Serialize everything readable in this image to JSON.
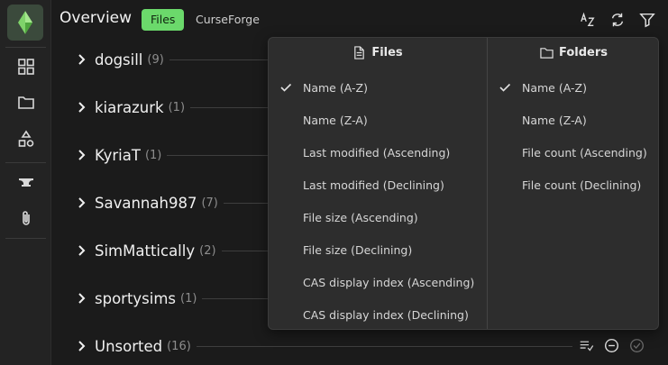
{
  "header": {
    "title": "Overview",
    "tabs": [
      {
        "label": "Files",
        "active": true
      },
      {
        "label": "CurseForge",
        "active": false
      }
    ],
    "icons": [
      "sort-az-icon",
      "refresh-icon",
      "filter-icon"
    ]
  },
  "sidebar": {
    "items": [
      "dashboard-icon",
      "folder-icon",
      "shapes-icon",
      "anvil-icon",
      "paperclip-icon"
    ]
  },
  "tree": {
    "rows": [
      {
        "name": "dogsill",
        "count": "(9)"
      },
      {
        "name": "kiarazurk",
        "count": "(1)"
      },
      {
        "name": "KyriaT",
        "count": "(1)"
      },
      {
        "name": "Savannah987",
        "count": "(7)"
      },
      {
        "name": "SimMattically",
        "count": "(2)"
      },
      {
        "name": "sportysims",
        "count": "(1)"
      },
      {
        "name": "Unsorted",
        "count": "(16)"
      }
    ]
  },
  "sort_menu": {
    "files": {
      "heading": "Files",
      "options": [
        {
          "label": "Name (A-Z)",
          "selected": true
        },
        {
          "label": "Name (Z-A)",
          "selected": false
        },
        {
          "label": "Last modified (Ascending)",
          "selected": false
        },
        {
          "label": "Last modified (Declining)",
          "selected": false
        },
        {
          "label": "File size (Ascending)",
          "selected": false
        },
        {
          "label": "File size (Declining)",
          "selected": false
        },
        {
          "label": "CAS display index (Ascending)",
          "selected": false
        },
        {
          "label": "CAS display index (Declining)",
          "selected": false
        }
      ]
    },
    "folders": {
      "heading": "Folders",
      "options": [
        {
          "label": "Name (A-Z)",
          "selected": true
        },
        {
          "label": "Name (Z-A)",
          "selected": false
        },
        {
          "label": "File count (Ascending)",
          "selected": false
        },
        {
          "label": "File count (Declining)",
          "selected": false
        }
      ]
    }
  },
  "colors": {
    "accent": "#6bd96b",
    "background": "#1b1b1b",
    "panel": "#2d2d2d"
  }
}
